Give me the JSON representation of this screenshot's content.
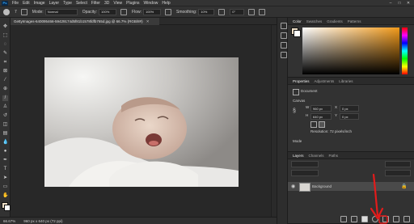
{
  "menubar": {
    "logo": "Ps",
    "items": [
      "File",
      "Edit",
      "Image",
      "Layer",
      "Type",
      "Select",
      "Filter",
      "3D",
      "View",
      "Plugins",
      "Window",
      "Help"
    ]
  },
  "window_controls": {
    "minimize": "–",
    "maximize": "□",
    "close": "✕"
  },
  "options": {
    "size_value": "7",
    "mode_label": "Mode:",
    "mode_value": "Normal",
    "opacity_label": "Opacity:",
    "opacity_value": "100%",
    "flow_label": "Flow:",
    "flow_value": "100%",
    "smoothing_label": "Smoothing:",
    "smoothing_value": "10%",
    "angle_value": "0°"
  },
  "document": {
    "tab_title": "GettyImages-640095466-59429174d5f81b1578fdfb765d.jpg @ 66.7% (RGB/8#)",
    "close": "✕"
  },
  "status": {
    "zoom": "66.67%",
    "doc_size": "960 px x 640 px (72 ppi)"
  },
  "color_panel": {
    "tabs": [
      "Color",
      "Swatches",
      "Gradients",
      "Patterns"
    ]
  },
  "properties_panel": {
    "tabs": [
      "Properties",
      "Adjustments",
      "Libraries"
    ],
    "document_label": "Document",
    "canvas_label": "Canvas",
    "width_label": "W",
    "width_value": "960 px",
    "height_label": "H",
    "height_value": "640 px",
    "x_label": "X",
    "x_value": "0 px",
    "y_label": "Y",
    "y_value": "0 px",
    "resolution": "Resolution: 72 pixels/inch",
    "mode_label": "Mode"
  },
  "layers_panel": {
    "tabs": [
      "Layers",
      "Channels",
      "Paths"
    ],
    "layer_name": "Background"
  },
  "colors": {
    "foreground": "#eedfc7",
    "background": "#ffffff",
    "annotation_red": "#e21b1b"
  }
}
